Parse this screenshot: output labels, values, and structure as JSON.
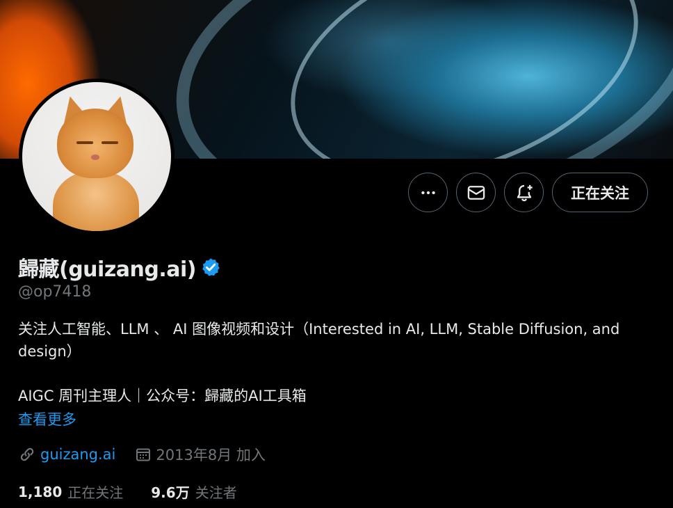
{
  "profile": {
    "display_name": "歸藏(guizang.ai)",
    "handle": "@op7418",
    "verified_icon": "verified-badge-icon",
    "bio_line1": "关注人工智能、LLM 、 AI 图像视频和设计（Interested in AI, LLM, Stable Diffusion, and design）",
    "bio_line2": "AIGC 周刊主理人｜公众号：歸藏的AI工具箱",
    "show_more": "查看更多",
    "website": "guizang.ai",
    "joined": "2013年8月 加入",
    "following_count": "1,180",
    "following_label": "正在关注",
    "followers_count": "9.6万",
    "followers_label": "关注者"
  },
  "actions": {
    "more_icon": "more-icon",
    "message_icon": "mail-icon",
    "notify_icon": "bell-plus-icon",
    "follow_label": "正在关注"
  },
  "colors": {
    "accent": "#1d9bf0",
    "background": "#000000",
    "text": "#e7e9ea",
    "muted": "#71767b",
    "border": "#536471"
  }
}
